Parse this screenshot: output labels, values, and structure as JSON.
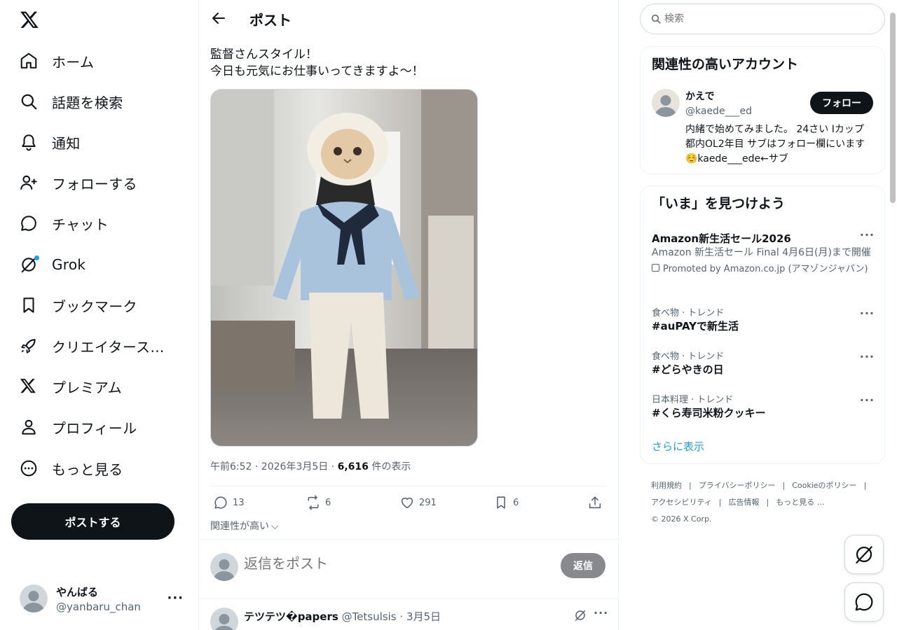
{
  "leftnav": {
    "items": [
      {
        "label": "ホーム",
        "icon": "home-icon"
      },
      {
        "label": "話題を検索",
        "icon": "search-icon"
      },
      {
        "label": "通知",
        "icon": "bell-icon"
      },
      {
        "label": "フォローする",
        "icon": "person-add-icon"
      },
      {
        "label": "チャット",
        "icon": "chat-icon"
      },
      {
        "label": "Grok",
        "icon": "grok-icon"
      },
      {
        "label": "ブックマーク",
        "icon": "bookmark-icon"
      },
      {
        "label": "クリエイタースタ…",
        "icon": "rocket-icon"
      },
      {
        "label": "プレミアム",
        "icon": "x-icon"
      },
      {
        "label": "プロフィール",
        "icon": "person-icon"
      },
      {
        "label": "もっと見る",
        "icon": "more-circle-icon"
      }
    ],
    "post_button": "ポストする",
    "account": {
      "name": "やんばる",
      "handle": "@yanbaru_chan",
      "more": "···"
    }
  },
  "main": {
    "title": "ポスト",
    "post": {
      "line1": "監督さんスタイル！",
      "line2": "今日も元気にお仕事いってきますよ〜！",
      "time": "午前6:52 · 2026年3月5日 · ",
      "views": "6,616",
      "views_suffix": " 件の表示",
      "replies": "13",
      "reposts": "6",
      "likes": "291",
      "bookmarks": "6"
    },
    "sort_label": "関連性が高い",
    "reply": {
      "placeholder": "返信をポスト",
      "button": "返信"
    },
    "first_reply": {
      "name": "テツテツ�papers",
      "handle": "@Tetsulsis",
      "date": "3月5日"
    }
  },
  "right": {
    "search_placeholder": "検索",
    "related": {
      "title": "関連性の高いアカウント",
      "name": "かえで",
      "handle": "@kaede___ed",
      "follow": "フォロー",
      "bio": "内緒で始めてみました。 24さい Iカップ 都内OL2年目 サブはフォロー欄にいます☺️kaede___ede←サブ"
    },
    "trends": {
      "title": "「いま」を見つけよう",
      "items": [
        {
          "head": "Amazon新生活セール2026",
          "desc": "Amazon 新生活セール Final 4月6日(月)まで開催",
          "promo": "Promoted by Amazon.co.jp (アマゾンジャパン)"
        },
        {
          "context": "食べ物 · トレンド",
          "head": "#auPAYで新生活"
        },
        {
          "context": "食べ物 · トレンド",
          "head": "#どらやきの日"
        },
        {
          "context": "日本料理 · トレンド",
          "head": "#くら寿司米粉クッキー"
        }
      ],
      "show_more": "さらに表示"
    },
    "footer": [
      "利用規約",
      "|",
      "プライバシーポリシー",
      "|",
      "Cookieのポリシー",
      "|",
      "アクセシビリティ",
      "|",
      "広告情報",
      "|",
      "もっと見る …",
      "© 2026 X Corp."
    ]
  },
  "colors": {
    "accent": "#1d9bf0",
    "text": "#0f1419",
    "muted": "#536471",
    "border": "#eff3f4"
  }
}
